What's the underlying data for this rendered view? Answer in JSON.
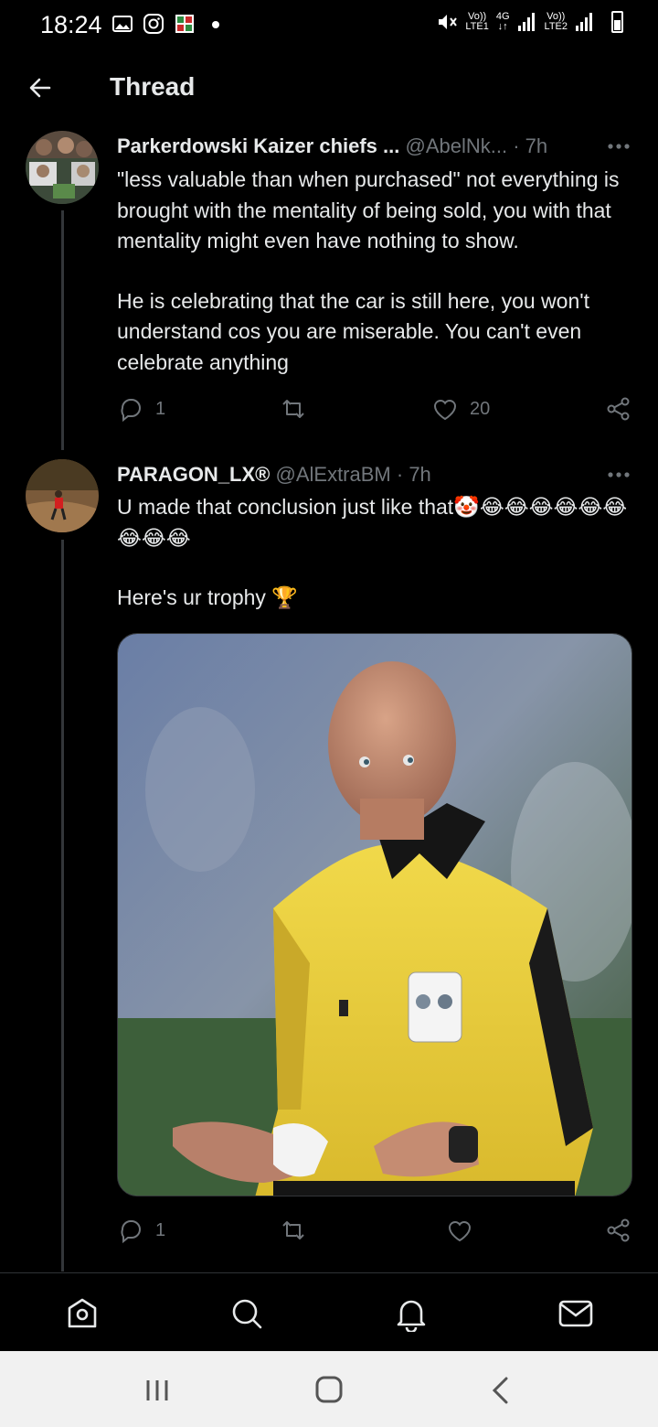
{
  "status_bar": {
    "time": "18:24",
    "sim1": {
      "top": "Vo))",
      "bottom": "LTE1"
    },
    "network": {
      "top": "4G",
      "bottom": "↓↑"
    },
    "sim2": {
      "top": "Vo))",
      "bottom": "LTE2"
    },
    "icons": [
      "gallery-icon",
      "instagram-icon",
      "app-icon",
      "dot-icon",
      "mute-icon",
      "signal-icon",
      "battery-icon"
    ]
  },
  "header": {
    "title": "Thread",
    "back_icon": "arrow-left-icon"
  },
  "tweets": [
    {
      "display_name": "Parkerdowski Kaizer chiefs ...",
      "handle": "@AbelNk...",
      "time": "· 7h",
      "paragraphs": [
        "\"less valuable than when purchased\" not everything is brought with the mentality of being sold, you with that mentality might even have nothing to show.",
        "He is celebrating that the car is still here, you won't understand cos you are miserable. You can't even celebrate anything"
      ],
      "replies": "1",
      "retweets": "",
      "likes": "20"
    },
    {
      "display_name": "PARAGON_LX®",
      "handle": "@AlExtraBM",
      "time": "· 7h",
      "paragraphs": [
        "U made that conclusion just like that🤡😂😂😂😂😂😂😂😂😂",
        "Here's ur trophy 🏆"
      ],
      "media": "referee-photo",
      "replies": "1",
      "retweets": "",
      "likes": ""
    }
  ],
  "tab_bar": {
    "items": [
      "home-icon",
      "search-icon",
      "notifications-icon",
      "messages-icon"
    ]
  },
  "nav_bar": {
    "items": [
      "recent-apps-icon",
      "home-button-icon",
      "back-nav-icon"
    ]
  },
  "colors": {
    "background": "#000000",
    "text": "#e7e9ea",
    "muted": "#71767b",
    "divider": "#2f3336"
  }
}
